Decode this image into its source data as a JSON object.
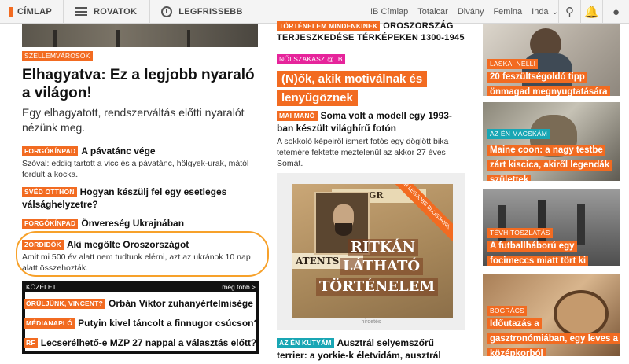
{
  "nav": {
    "home": "CÍMLAP",
    "sections": "ROVATOK",
    "latest": "LEGFRISSEBB",
    "sites": [
      "!B Címlap",
      "Totalcar",
      "Divány",
      "Femina",
      "Inda"
    ]
  },
  "left": {
    "lead": {
      "tag": "SZELLEMVÁROSOK",
      "title": "Elhagyatva: Ez a legjobb nyaraló a világon!",
      "lede": "Egy elhagyatott, rendszerváltás előtti nyaralót nézünk meg."
    },
    "items": [
      {
        "tag": "FORGÓKÍNPAD",
        "title": "A pávatánc vége",
        "lede": "Szóval: eddig tartott a vicc és a pávatánc, hölgyek-urak, mától fordult a kocka."
      },
      {
        "tag": "SVÉD OTTHON",
        "title": "Hogyan készülj fel egy esetleges válsághelyzetre?",
        "lede": ""
      },
      {
        "tag": "FORGÓKÍNPAD",
        "title": "Önvereség Ukrajnában",
        "lede": ""
      },
      {
        "tag": "ZORDIDŐK",
        "title": "Aki megölte Oroszországot",
        "lede": "Amit mi 500 év alatt nem tudtunk elérni, azt az ukránok 10 nap alatt összehozták."
      }
    ],
    "kozelet": {
      "label": "KÖZÉLET",
      "more": "még több >",
      "items": [
        {
          "tag": "ÖRÜLJÜNK, VINCENT?",
          "title": "Orbán Viktor zuhanyértelmisége"
        },
        {
          "tag": "MÉDIANAPLÓ",
          "title": "Putyin kivel táncolt a finnugor csúcson?"
        },
        {
          "tag": "RF",
          "title": "Lecserélhető-e MZP 27 nappal a választás előtt?"
        }
      ]
    }
  },
  "middle": {
    "top": {
      "tag": "TÖRTÉNELEM MINDENKINEK",
      "title": "OROSZORSZÁG TERJESZKEDÉSE TÉRKÉPEKEN 1300-1945"
    },
    "feature": {
      "tag": "NŐI SZAKASZ @ !B",
      "title": "(N)ők, akik motiválnak és lenyűgöznek"
    },
    "story": {
      "tag": "MAI MANÓ",
      "title": "Soma volt a modell egy 1993-ban készült világhírű fotón",
      "lede": "A sokkoló képeiről ismert fotós egy döglött bika tetemére fektette meztelenül az akkor 27 éves Somát."
    },
    "ad": {
      "ribbon": "!B LEGJOBB BLOGJAINK",
      "line1": "RITKÁN",
      "line2": "LÁTHATÓ",
      "line3": "TÖRTÉNELEM",
      "label": "hirdetés",
      "posters": [
        "LITHOGR",
        "ATENTS"
      ]
    },
    "bottom": {
      "tag": "AZ ÉN KUTYÁM",
      "title": "Ausztrál selyemszőrű terrier: a yorkie-k életvidám, ausztrál rokona"
    }
  },
  "right": {
    "cards": [
      {
        "tag": "LASKAI NELLI",
        "title": "20 feszültségoldó tipp önmagad megnyugtatására"
      },
      {
        "tag": "AZ ÉN MACSKÁM",
        "title": "Maine coon: a nagy testbe zárt kiscica, akiről legendák születtek"
      },
      {
        "tag": "TÉVHITOSZLATÁS",
        "title": "A futballháború egy focimeccs miatt tört ki"
      },
      {
        "tag": "BOGRÁCS",
        "title": "Időutazás a gasztronómiában, egy leves a középkorból"
      }
    ]
  },
  "colors": {
    "accent": "#f26b21",
    "pink": "#e6249b",
    "teal": "#19a6b4",
    "highlight": "#f7a12a"
  },
  "icons": [
    "hamburger-icon",
    "clock-icon",
    "search-icon",
    "bell-icon",
    "user-icon",
    "chevron-down-icon"
  ]
}
